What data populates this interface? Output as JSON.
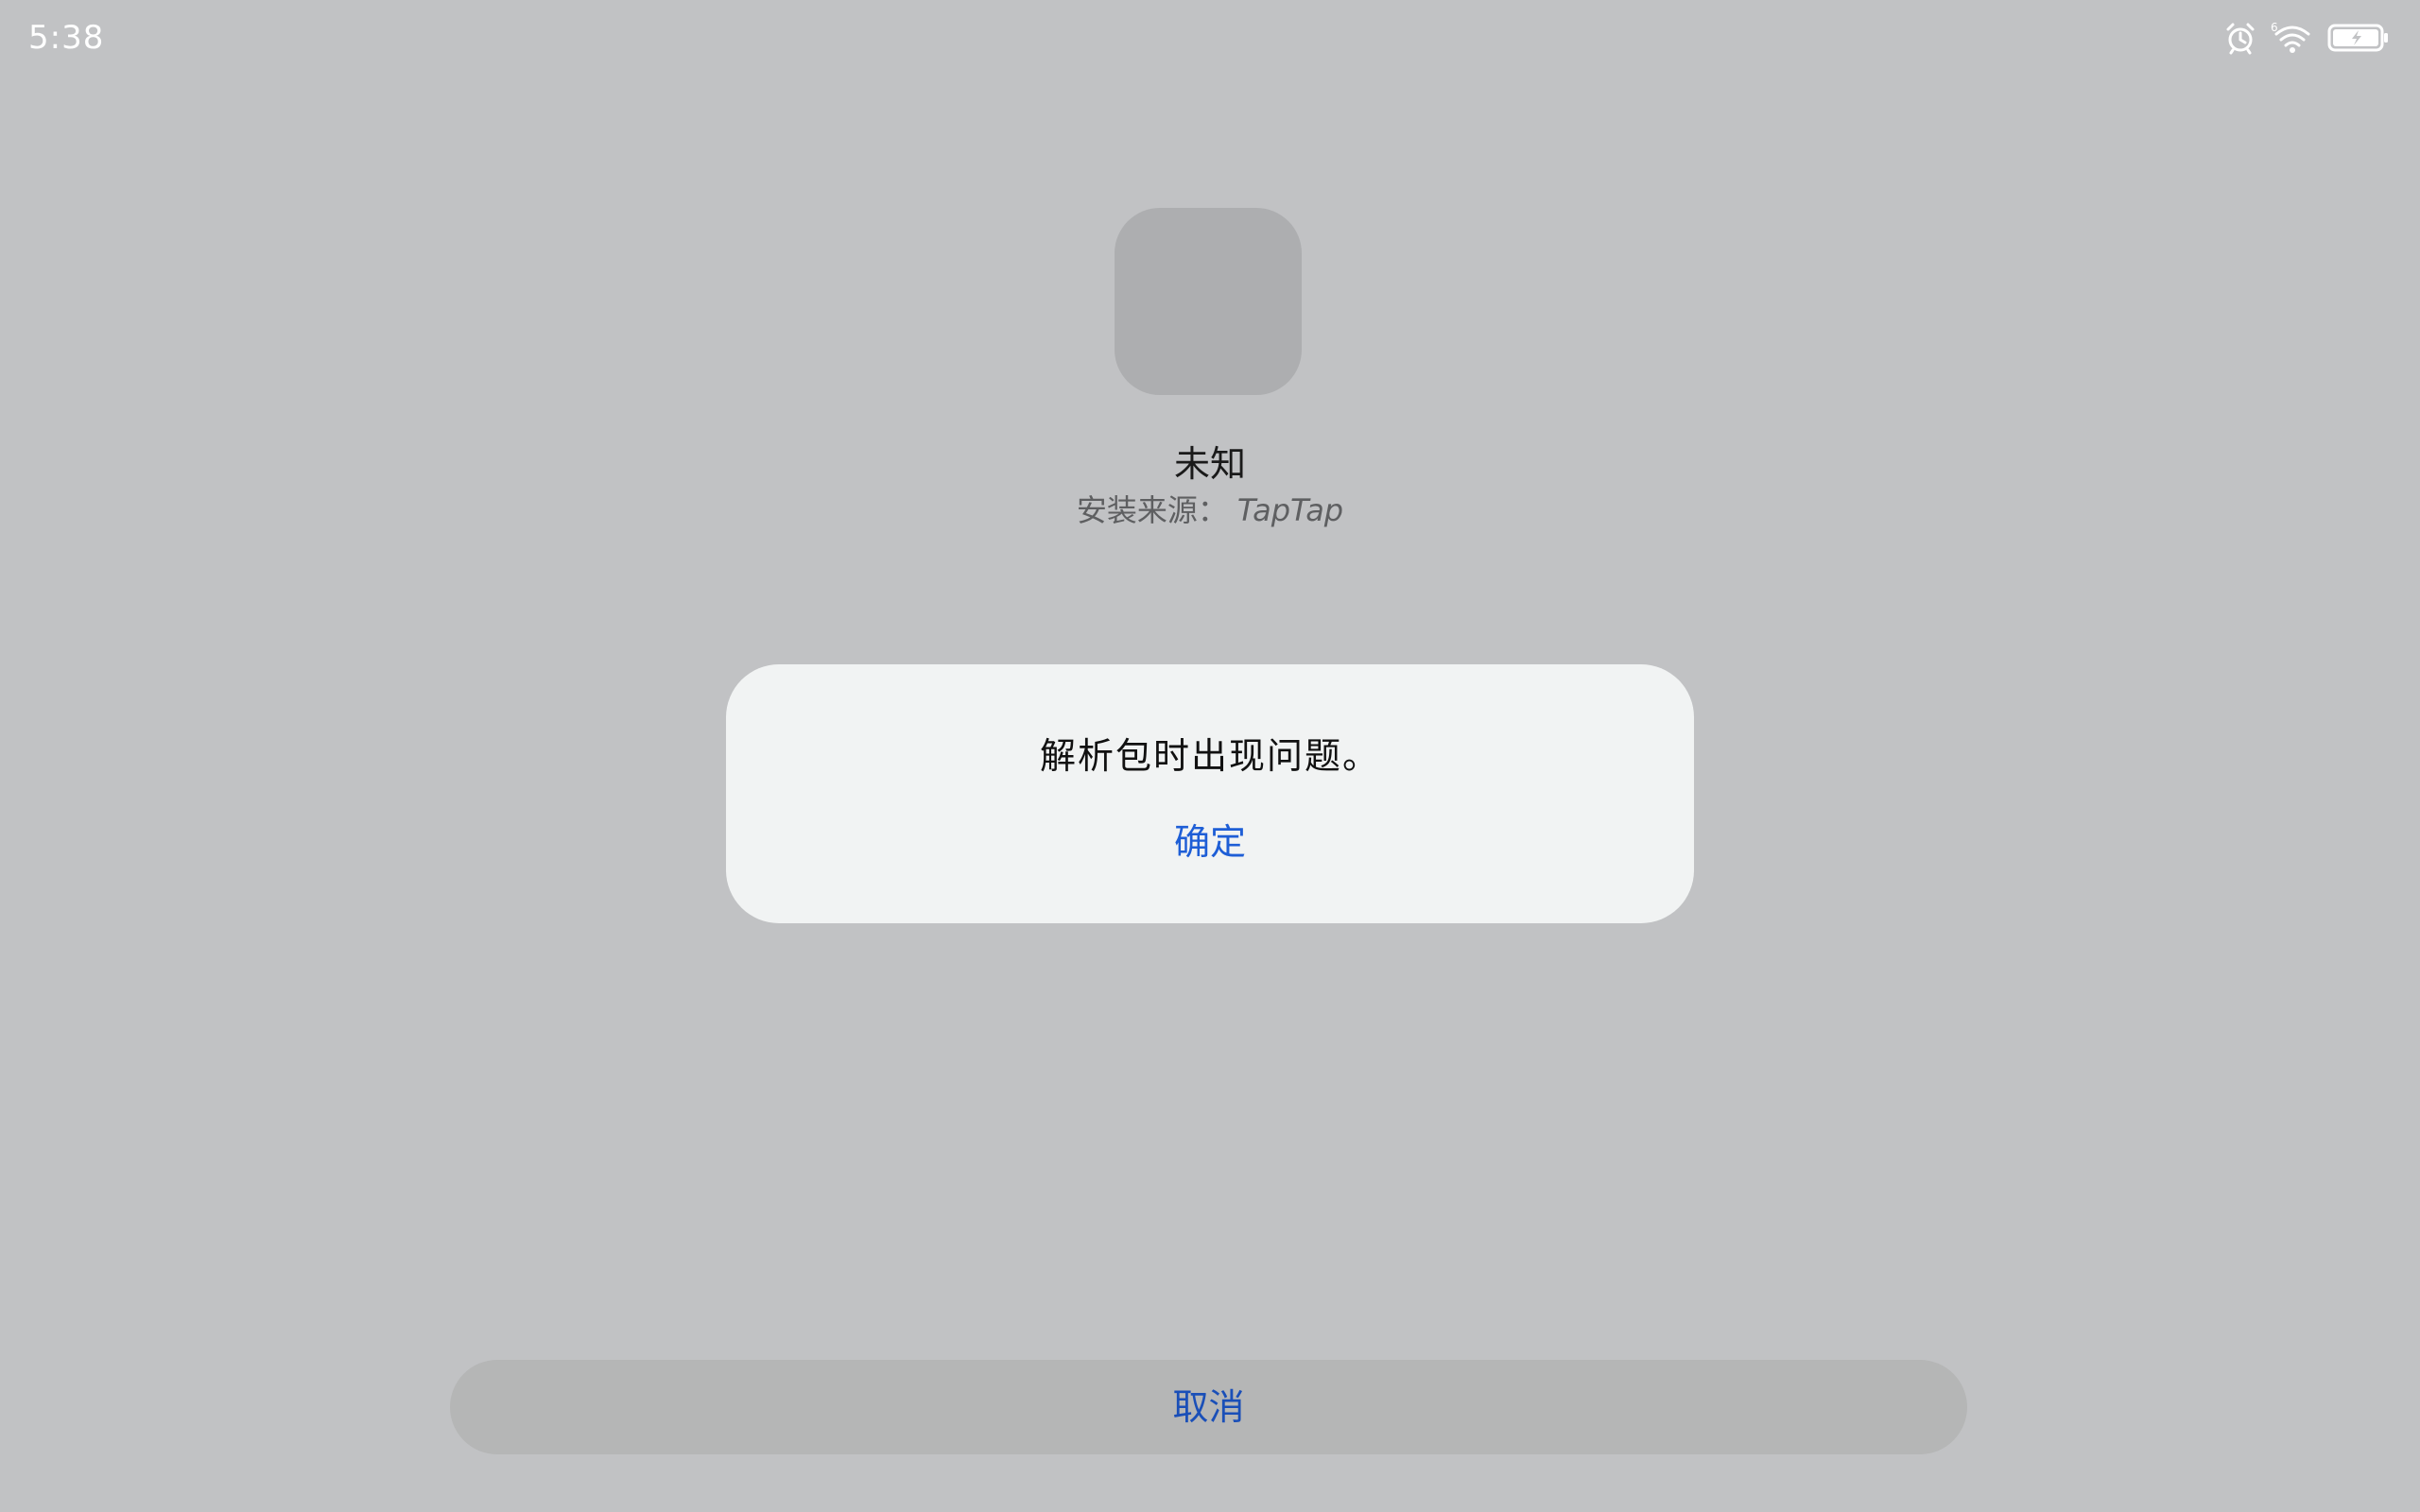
{
  "status_bar": {
    "time": "5:38",
    "icons": [
      "alarm-icon",
      "wifi-icon",
      "battery-charging-icon"
    ]
  },
  "app": {
    "name": "未知",
    "source_label": "安装来源：",
    "source_value": "TapTap"
  },
  "dialog": {
    "message": "解析包时出现问题。",
    "confirm_label": "确定"
  },
  "footer": {
    "cancel_label": "取消"
  },
  "colors": {
    "background": "#c1c2c4",
    "dialog_background": "#f1f3f3",
    "accent": "#1e5ed6",
    "cancel_background": "#b5b6b6"
  }
}
